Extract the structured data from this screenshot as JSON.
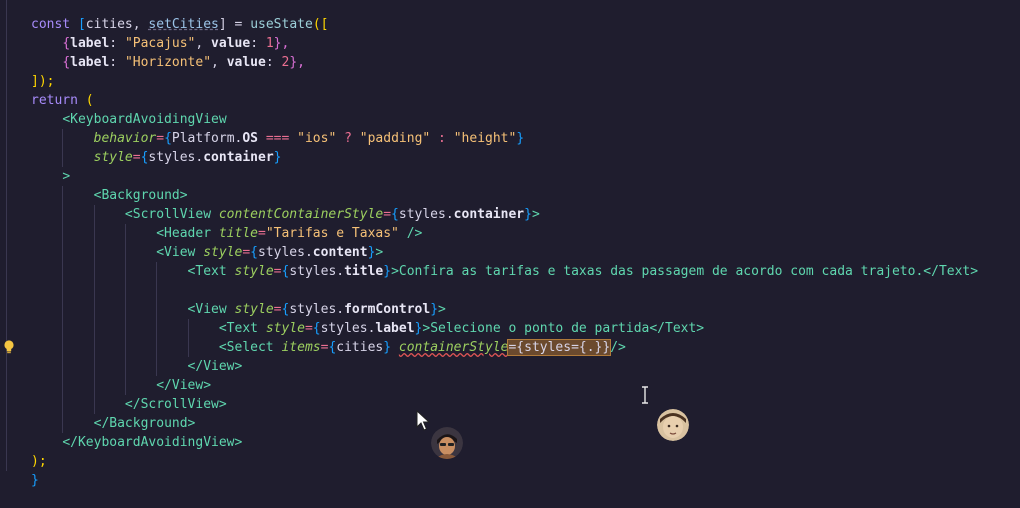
{
  "editor": {
    "theme_colors": {
      "background": "#1f1d2e",
      "keyword": "#a78bfa",
      "tag": "#5fd7af",
      "attribute": "#9ccf5f",
      "string": "#f6c177",
      "number": "#eb6f92"
    },
    "lines": [
      {
        "tokens": [
          {
            "t": "const ",
            "c": "keyword"
          },
          {
            "t": "[",
            "c": "brace3"
          },
          {
            "t": "cities",
            "c": "var"
          },
          {
            "t": ", ",
            "c": "plain"
          },
          {
            "t": "setCities",
            "c": "setter"
          },
          {
            "t": "] = ",
            "c": "plain"
          },
          {
            "t": "useState",
            "c": "func"
          },
          {
            "t": "([",
            "c": "brace1"
          }
        ]
      },
      {
        "tokens": [
          {
            "t": "    ",
            "c": "plain"
          },
          {
            "t": "{",
            "c": "brace2"
          },
          {
            "t": "label",
            "c": "prop"
          },
          {
            "t": ": ",
            "c": "plain"
          },
          {
            "t": "\"Pacajus\"",
            "c": "string"
          },
          {
            "t": ", ",
            "c": "plain"
          },
          {
            "t": "value",
            "c": "prop"
          },
          {
            "t": ": ",
            "c": "plain"
          },
          {
            "t": "1",
            "c": "number"
          },
          {
            "t": "},",
            "c": "brace2"
          }
        ]
      },
      {
        "tokens": [
          {
            "t": "    ",
            "c": "plain"
          },
          {
            "t": "{",
            "c": "brace2"
          },
          {
            "t": "label",
            "c": "prop"
          },
          {
            "t": ": ",
            "c": "plain"
          },
          {
            "t": "\"Horizonte\"",
            "c": "string"
          },
          {
            "t": ", ",
            "c": "plain"
          },
          {
            "t": "value",
            "c": "prop"
          },
          {
            "t": ": ",
            "c": "plain"
          },
          {
            "t": "2",
            "c": "number"
          },
          {
            "t": "},",
            "c": "brace2"
          }
        ]
      },
      {
        "tokens": [
          {
            "t": "]);",
            "c": "brace1"
          }
        ]
      },
      {
        "tokens": [
          {
            "t": "return ",
            "c": "keyword"
          },
          {
            "t": "(",
            "c": "brace1"
          }
        ]
      },
      {
        "tokens": [
          {
            "t": "    ",
            "c": "plain"
          },
          {
            "t": "<KeyboardAvoidingView",
            "c": "tag"
          }
        ]
      },
      {
        "tokens": [
          {
            "t": "        ",
            "c": "plain"
          },
          {
            "t": "behavior",
            "c": "attr"
          },
          {
            "t": "=",
            "c": "op"
          },
          {
            "t": "{",
            "c": "brace3"
          },
          {
            "t": "Platform",
            "c": "var"
          },
          {
            "t": ".",
            "c": "plain"
          },
          {
            "t": "OS",
            "c": "prop"
          },
          {
            "t": " === ",
            "c": "op"
          },
          {
            "t": "\"ios\"",
            "c": "string"
          },
          {
            "t": " ? ",
            "c": "op"
          },
          {
            "t": "\"padding\"",
            "c": "string"
          },
          {
            "t": " : ",
            "c": "op"
          },
          {
            "t": "\"height\"",
            "c": "string"
          },
          {
            "t": "}",
            "c": "brace3"
          }
        ]
      },
      {
        "tokens": [
          {
            "t": "        ",
            "c": "plain"
          },
          {
            "t": "style",
            "c": "attr"
          },
          {
            "t": "=",
            "c": "op"
          },
          {
            "t": "{",
            "c": "brace3"
          },
          {
            "t": "styles",
            "c": "var"
          },
          {
            "t": ".",
            "c": "plain"
          },
          {
            "t": "container",
            "c": "prop"
          },
          {
            "t": "}",
            "c": "brace3"
          }
        ]
      },
      {
        "tokens": [
          {
            "t": "    ",
            "c": "plain"
          },
          {
            "t": ">",
            "c": "tag"
          }
        ]
      },
      {
        "tokens": [
          {
            "t": "        ",
            "c": "plain"
          },
          {
            "t": "<Background>",
            "c": "tag"
          }
        ]
      },
      {
        "tokens": [
          {
            "t": "            ",
            "c": "plain"
          },
          {
            "t": "<ScrollView ",
            "c": "tag"
          },
          {
            "t": "contentContainerStyle",
            "c": "attr"
          },
          {
            "t": "=",
            "c": "op"
          },
          {
            "t": "{",
            "c": "brace3"
          },
          {
            "t": "styles",
            "c": "var"
          },
          {
            "t": ".",
            "c": "plain"
          },
          {
            "t": "container",
            "c": "prop"
          },
          {
            "t": "}",
            "c": "brace3"
          },
          {
            "t": ">",
            "c": "tag"
          }
        ]
      },
      {
        "tokens": [
          {
            "t": "                ",
            "c": "plain"
          },
          {
            "t": "<Header ",
            "c": "tag"
          },
          {
            "t": "title",
            "c": "attr"
          },
          {
            "t": "=",
            "c": "op"
          },
          {
            "t": "\"Tarifas e Taxas\"",
            "c": "string"
          },
          {
            "t": " />",
            "c": "tag"
          }
        ]
      },
      {
        "tokens": [
          {
            "t": "                ",
            "c": "plain"
          },
          {
            "t": "<View ",
            "c": "tag"
          },
          {
            "t": "style",
            "c": "attr"
          },
          {
            "t": "=",
            "c": "op"
          },
          {
            "t": "{",
            "c": "brace3"
          },
          {
            "t": "styles",
            "c": "var"
          },
          {
            "t": ".",
            "c": "plain"
          },
          {
            "t": "content",
            "c": "prop"
          },
          {
            "t": "}",
            "c": "brace3"
          },
          {
            "t": ">",
            "c": "tag"
          }
        ]
      },
      {
        "tokens": [
          {
            "t": "                    ",
            "c": "plain"
          },
          {
            "t": "<Text ",
            "c": "tag"
          },
          {
            "t": "style",
            "c": "attr"
          },
          {
            "t": "=",
            "c": "op"
          },
          {
            "t": "{",
            "c": "brace3"
          },
          {
            "t": "styles",
            "c": "var"
          },
          {
            "t": ".",
            "c": "plain"
          },
          {
            "t": "title",
            "c": "prop"
          },
          {
            "t": "}",
            "c": "brace3"
          },
          {
            "t": ">Confira as tarifas e taxas das passagem de acordo com cada trajeto.</Text>",
            "c": "tag"
          }
        ]
      },
      {
        "tokens": []
      },
      {
        "tokens": [
          {
            "t": "                    ",
            "c": "plain"
          },
          {
            "t": "<View ",
            "c": "tag"
          },
          {
            "t": "style",
            "c": "attr"
          },
          {
            "t": "=",
            "c": "op"
          },
          {
            "t": "{",
            "c": "brace3"
          },
          {
            "t": "styles",
            "c": "var"
          },
          {
            "t": ".",
            "c": "plain"
          },
          {
            "t": "formControl",
            "c": "prop"
          },
          {
            "t": "}",
            "c": "brace3"
          },
          {
            "t": ">",
            "c": "tag"
          }
        ]
      },
      {
        "tokens": [
          {
            "t": "                        ",
            "c": "plain"
          },
          {
            "t": "<Text ",
            "c": "tag"
          },
          {
            "t": "style",
            "c": "attr"
          },
          {
            "t": "=",
            "c": "op"
          },
          {
            "t": "{",
            "c": "brace3"
          },
          {
            "t": "styles",
            "c": "var"
          },
          {
            "t": ".",
            "c": "plain"
          },
          {
            "t": "label",
            "c": "prop"
          },
          {
            "t": "}",
            "c": "brace3"
          },
          {
            "t": ">Selecione o ponto de partida</Text>",
            "c": "tag"
          }
        ]
      },
      {
        "tokens": [
          {
            "t": "                        ",
            "c": "plain"
          },
          {
            "t": "<Select ",
            "c": "tag"
          },
          {
            "t": "items",
            "c": "attr"
          },
          {
            "t": "=",
            "c": "op"
          },
          {
            "t": "{",
            "c": "brace3"
          },
          {
            "t": "cities",
            "c": "var"
          },
          {
            "t": "}",
            "c": "brace3"
          },
          {
            "t": " ",
            "c": "plain"
          },
          {
            "t": "containerStyle",
            "c": "attr-squiggle"
          },
          {
            "t": "={styles={.}}",
            "c": "selected"
          },
          {
            "t": "/>",
            "c": "tag"
          }
        ]
      },
      {
        "tokens": [
          {
            "t": "                    ",
            "c": "plain"
          },
          {
            "t": "</View>",
            "c": "tag"
          }
        ]
      },
      {
        "tokens": [
          {
            "t": "                ",
            "c": "plain"
          },
          {
            "t": "</View>",
            "c": "tag"
          }
        ]
      },
      {
        "tokens": [
          {
            "t": "            ",
            "c": "plain"
          },
          {
            "t": "</ScrollView>",
            "c": "tag"
          }
        ]
      },
      {
        "tokens": [
          {
            "t": "        ",
            "c": "plain"
          },
          {
            "t": "</Background>",
            "c": "tag"
          }
        ]
      },
      {
        "tokens": [
          {
            "t": "    ",
            "c": "plain"
          },
          {
            "t": "</KeyboardAvoidingView>",
            "c": "tag"
          }
        ]
      },
      {
        "tokens": [
          {
            "t": ");",
            "c": "brace1"
          }
        ]
      },
      {
        "tokens": [
          {
            "t": "}",
            "c": "brace3"
          }
        ]
      }
    ]
  },
  "overlay": {
    "lightbulb_icon": "lightbulb-icon",
    "text_cursor_icon": "i-beam-cursor-icon",
    "mouse_pointer_icon": "mouse-pointer-icon",
    "avatars": [
      "collaborator-avatar",
      "collaborator-avatar"
    ]
  }
}
